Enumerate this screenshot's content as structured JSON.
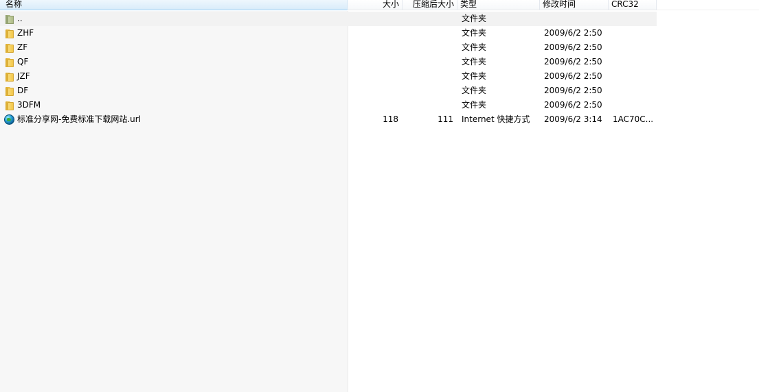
{
  "columns": {
    "name": "名称",
    "size": "大小",
    "packed_size": "压缩后大小",
    "type": "类型",
    "modified": "修改时间",
    "crc": "CRC32"
  },
  "rows": [
    {
      "icon": "up-folder-icon",
      "name": "..",
      "size": "",
      "packed": "",
      "type": "文件夹",
      "modified": "",
      "crc": ""
    },
    {
      "icon": "folder-icon",
      "name": "ZHF",
      "size": "",
      "packed": "",
      "type": "文件夹",
      "modified": "2009/6/2 2:50",
      "crc": ""
    },
    {
      "icon": "folder-icon",
      "name": "ZF",
      "size": "",
      "packed": "",
      "type": "文件夹",
      "modified": "2009/6/2 2:50",
      "crc": ""
    },
    {
      "icon": "folder-icon",
      "name": "QF",
      "size": "",
      "packed": "",
      "type": "文件夹",
      "modified": "2009/6/2 2:50",
      "crc": ""
    },
    {
      "icon": "folder-icon",
      "name": "JZF",
      "size": "",
      "packed": "",
      "type": "文件夹",
      "modified": "2009/6/2 2:50",
      "crc": ""
    },
    {
      "icon": "folder-icon",
      "name": "DF",
      "size": "",
      "packed": "",
      "type": "文件夹",
      "modified": "2009/6/2 2:50",
      "crc": ""
    },
    {
      "icon": "folder-icon",
      "name": "3DFM",
      "size": "",
      "packed": "",
      "type": "文件夹",
      "modified": "2009/6/2 2:50",
      "crc": ""
    },
    {
      "icon": "globe-icon",
      "name": "标准分享网-免费标准下载网站.url",
      "size": "118",
      "packed": "111",
      "type": "Internet 快捷方式",
      "modified": "2009/6/2 3:14",
      "crc": "1AC70C..."
    }
  ]
}
